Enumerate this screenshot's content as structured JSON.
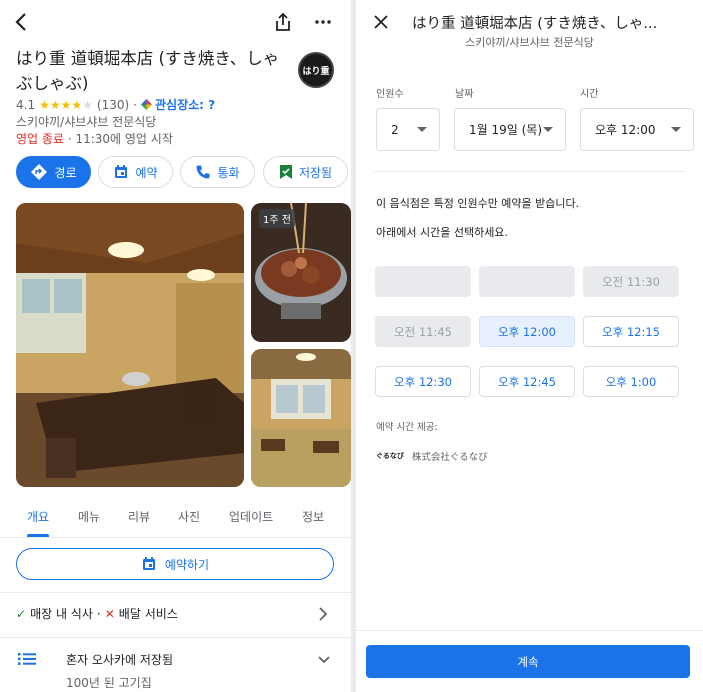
{
  "left_panel": {
    "place": {
      "name": "はり重 道頓堀本店 (すき焼き、しゃぶしゃぶ)",
      "rating": "4.1",
      "stars": "★★★★",
      "star_off": "★",
      "review_count": "(130)",
      "interest": "관심장소: ?",
      "category": "스키야끼/샤브샤브 전문식당",
      "status": "영업 종료",
      "next_open": "· 11:30에 영업 시작",
      "logo_text": "はり重"
    },
    "actions": [
      {
        "label": "경로",
        "icon": "directions-icon"
      },
      {
        "label": "예약",
        "icon": "calendar-icon"
      },
      {
        "label": "통화",
        "icon": "phone-icon"
      },
      {
        "label": "저장됨",
        "icon": "bookmark-icon"
      }
    ],
    "photo_badge": "1주 전",
    "tabs": [
      "개요",
      "메뉴",
      "리뷰",
      "사진",
      "업데이트",
      "정보"
    ],
    "active_tab": "개요",
    "reserve_button": "예약하기",
    "services": {
      "dine_in": "매장 내 식사",
      "separator": "·",
      "delivery": "배달 서비스"
    },
    "saved": {
      "title": "혼자 오사카에 저장됨",
      "subtitle": "100년 된 고기집"
    }
  },
  "right_panel": {
    "title": "はり重 道頓堀本店 (すき焼き、しゃ...",
    "subtitle": "스키야끼/샤브샤브 전문식당",
    "party_label": "인원수",
    "party_value": "2",
    "date_label": "날짜",
    "date_value": "1월 19일 (목)",
    "time_label": "시간",
    "time_value": "오후 12:00",
    "notice": "이 음식점은 특정 인원수만 예약을 받습니다.",
    "instruction": "아래에서 시간을 선택하세요.",
    "slots": [
      {
        "label": "",
        "state": "blank"
      },
      {
        "label": "",
        "state": "blank"
      },
      {
        "label": "오전 11:30",
        "state": "disabled"
      },
      {
        "label": "오전 11:45",
        "state": "disabled"
      },
      {
        "label": "오후 12:00",
        "state": "selected"
      },
      {
        "label": "오후 12:15",
        "state": "available"
      },
      {
        "label": "오후 12:30",
        "state": "available"
      },
      {
        "label": "오후 12:45",
        "state": "available"
      },
      {
        "label": "오후 1:00",
        "state": "available"
      }
    ],
    "provider_label": "예약 시간 제공:",
    "provider_logo": "ぐるなび",
    "provider_name": "株式会社ぐるなび",
    "continue_button": "계속"
  },
  "colors": {
    "accent": "#1a73e8",
    "closed": "#d93025",
    "star": "#fbbc04",
    "check": "#188038"
  }
}
